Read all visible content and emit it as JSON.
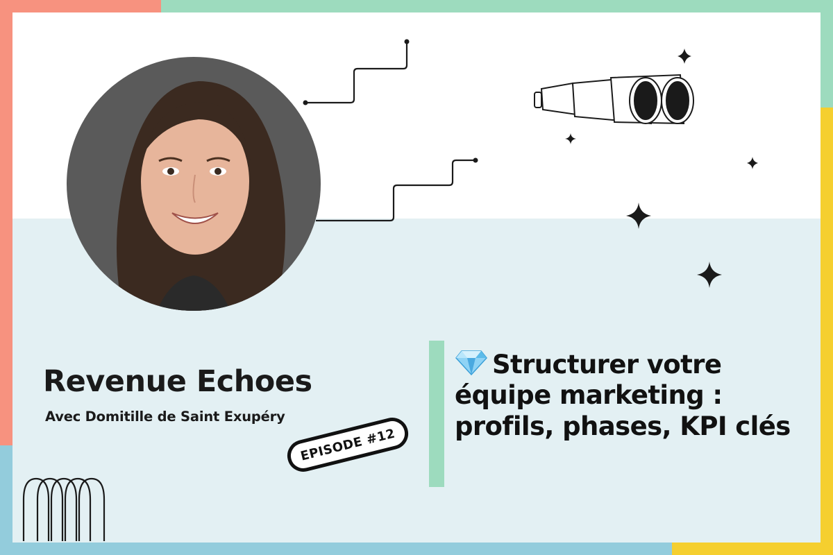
{
  "colors": {
    "frame_coral": "#f7927f",
    "frame_mint": "#9ddbbe",
    "frame_sky": "#93ccdc",
    "frame_yellow": "#f5cf2f",
    "background_lower": "#e3f0f3",
    "accent_bar": "#9ddbbe",
    "text_dark": "#111111"
  },
  "podcast": {
    "title": "Revenue Echoes",
    "guest_line": "Avec Domitille de Saint Exupéry",
    "episode_badge": "EPISODE #12"
  },
  "episode": {
    "title": "Structurer votre équipe marketing : profils, phases, KPI clés",
    "title_icon": "gem-icon"
  },
  "decorations": [
    "stairs-line",
    "binoculars-icon",
    "sparkle-icon",
    "arches-icon"
  ]
}
